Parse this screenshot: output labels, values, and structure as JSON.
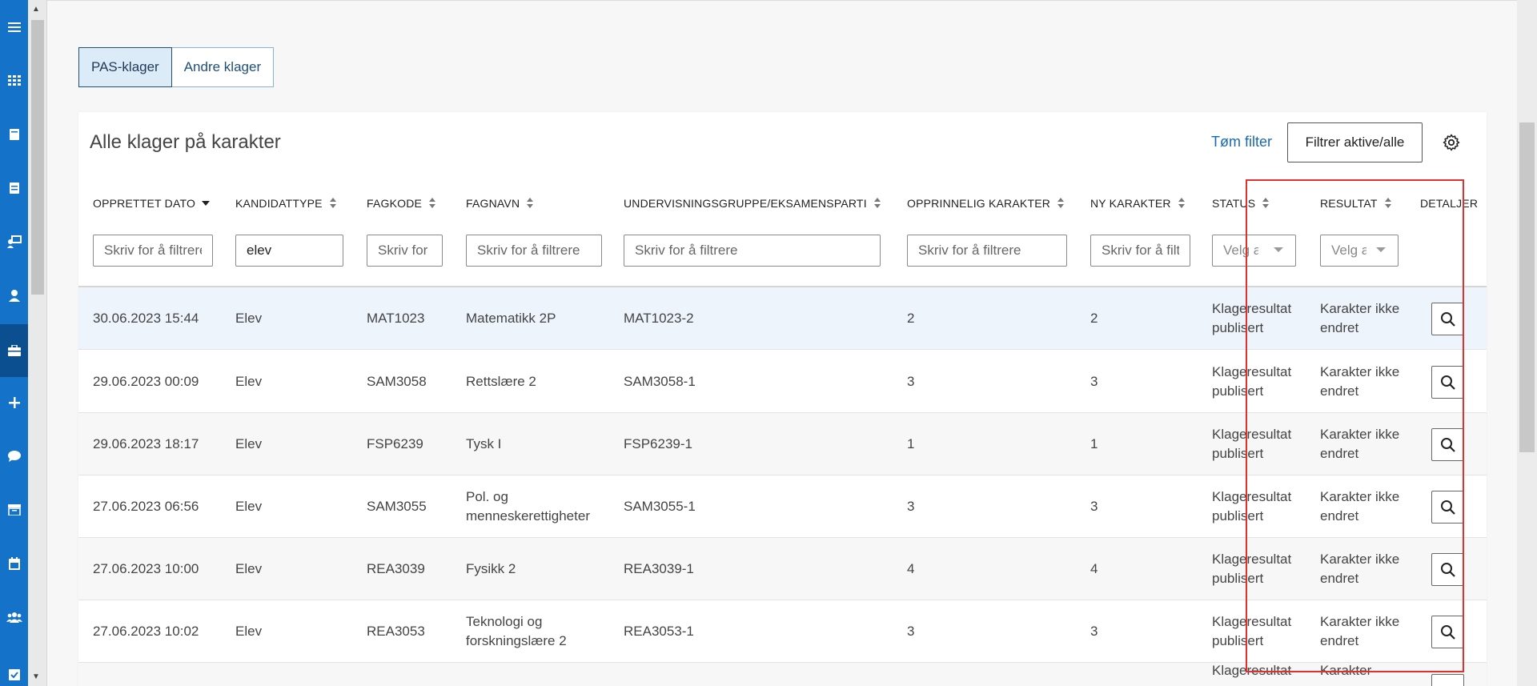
{
  "tabs": [
    {
      "label": "PAS-klager",
      "active": true
    },
    {
      "label": "Andre klager",
      "active": false
    }
  ],
  "card": {
    "title": "Alle klager på karakter",
    "clear_filter": "Tøm filter",
    "filter_toggle": "Filtrer aktive/alle"
  },
  "columns": {
    "date": "OPPRETTET DATO",
    "candidate_type": "KANDIDATTYPE",
    "subject_code": "FAGKODE",
    "subject_name": "FAGNAVN",
    "group": "UNDERVISNINGSGRUPPE/EKSAMENSPARTI",
    "original_grade": "OPPRINNELIG KARAKTER",
    "new_grade": "NY KARAKTER",
    "status": "STATUS",
    "result": "RESULTAT",
    "details": "DETALJER"
  },
  "filters": {
    "date_placeholder": "Skriv for å filtrere",
    "candidate_type_value": "elev",
    "subject_code_placeholder": "Skriv for å filtrere",
    "subject_name_placeholder": "Skriv for å filtrere",
    "group_placeholder": "Skriv for å filtrere",
    "original_grade_placeholder": "Skriv for å filtrere",
    "new_grade_placeholder": "Skriv for å filtrere",
    "status_placeholder": "Velg alle",
    "result_placeholder": "Velg alle"
  },
  "rows": [
    {
      "date": "30.06.2023 15:44",
      "type": "Elev",
      "code": "MAT1023",
      "name": "Matematikk 2P",
      "group": "MAT1023-2",
      "orig": "2",
      "new": "2",
      "status": "Klageresultat publisert",
      "result": "Karakter ikke endret"
    },
    {
      "date": "29.06.2023 00:09",
      "type": "Elev",
      "code": "SAM3058",
      "name": "Rettslære 2",
      "group": "SAM3058-1",
      "orig": "3",
      "new": "3",
      "status": "Klageresultat publisert",
      "result": "Karakter ikke endret"
    },
    {
      "date": "29.06.2023 18:17",
      "type": "Elev",
      "code": "FSP6239",
      "name": "Tysk I",
      "group": "FSP6239-1",
      "orig": "1",
      "new": "1",
      "status": "Klageresultat publisert",
      "result": "Karakter ikke endret"
    },
    {
      "date": "27.06.2023 06:56",
      "type": "Elev",
      "code": "SAM3055",
      "name": "Pol. og menneskerettigheter",
      "group": "SAM3055-1",
      "orig": "3",
      "new": "3",
      "status": "Klageresultat publisert",
      "result": "Karakter ikke endret"
    },
    {
      "date": "27.06.2023 10:00",
      "type": "Elev",
      "code": "REA3039",
      "name": "Fysikk 2",
      "group": "REA3039-1",
      "orig": "4",
      "new": "4",
      "status": "Klageresultat publisert",
      "result": "Karakter ikke endret"
    },
    {
      "date": "27.06.2023 10:02",
      "type": "Elev",
      "code": "REA3053",
      "name": "Teknologi og forskningslære 2",
      "group": "REA3053-1",
      "orig": "3",
      "new": "3",
      "status": "Klageresultat publisert",
      "result": "Karakter ikke endret"
    },
    {
      "date": "",
      "type": "",
      "code": "",
      "name": "",
      "group": "",
      "orig": "",
      "new": "",
      "status": "Klageresultat",
      "result": "Karakter"
    }
  ],
  "colors": {
    "nav": "#1473c9",
    "nav_active": "#0b4f91",
    "link": "#1769b2",
    "highlight_box": "#e0312f"
  }
}
